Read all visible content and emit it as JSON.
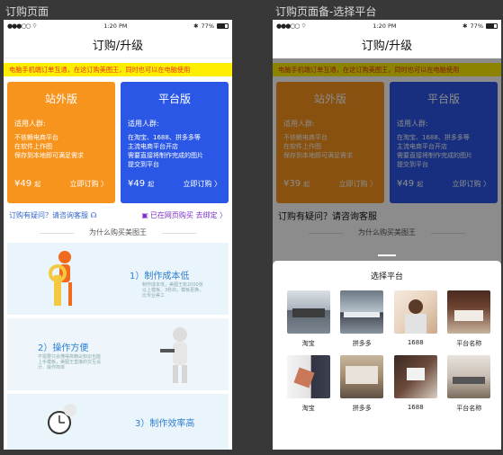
{
  "captions": {
    "left": "订购页面",
    "right": "订购页面备-选择平台"
  },
  "status_bar": {
    "signal": "●●●○○",
    "time": "1:20 PM",
    "battery": "77%"
  },
  "nav_title": "订购/升级",
  "notice": "电脑手机端订单互通，在这订购美图王，同时也可以在电脑使用",
  "cards": [
    {
      "title": "站外版",
      "audience": "适用人群:",
      "lines": [
        "不依赖电商平台",
        "在软件上作图",
        "保存到本地即可满足需求"
      ],
      "price": "¥49",
      "unit": "起",
      "buy": "立即订购 〉"
    },
    {
      "title": "平台版",
      "audience": "适用人群:",
      "lines": [
        "在淘宝、1688、拼多多等",
        "主流电商平台开店",
        "需要直接将制作完成的图片",
        "提交到平台"
      ],
      "price": "¥49",
      "unit": "起",
      "buy": "立即订购 〉"
    }
  ],
  "right_cards_price": "¥39",
  "help": {
    "question": "订购有疑问？请咨询客服",
    "right": "已在网页购买 去绑定 〉"
  },
  "help_right_phone": "订购有疑问？请咨询客服",
  "why_title": "为什么购买美图王",
  "features": [
    {
      "title": "1）制作成本低",
      "desc": "制作成本低，美图王有2000张以上模板、3秒出，模板更换，比专业美工"
    },
    {
      "title": "2）操作方便",
      "desc": "不需要只会懂得高精尖知识也能上手模板，美图王直接的交互设计、操作简单"
    },
    {
      "title": "3）制作效率高",
      "desc": ""
    }
  ],
  "sheet": {
    "title": "选择平台",
    "platforms": [
      "淘宝",
      "拼多多",
      "1688",
      "平台名称",
      "淘宝",
      "拼多多",
      "1688",
      "平台名称"
    ]
  },
  "colors": {
    "orange": "#f7941d",
    "blue": "#2b57e6",
    "notice_bg": "#ffee00",
    "notice_text": "#e8361e"
  }
}
